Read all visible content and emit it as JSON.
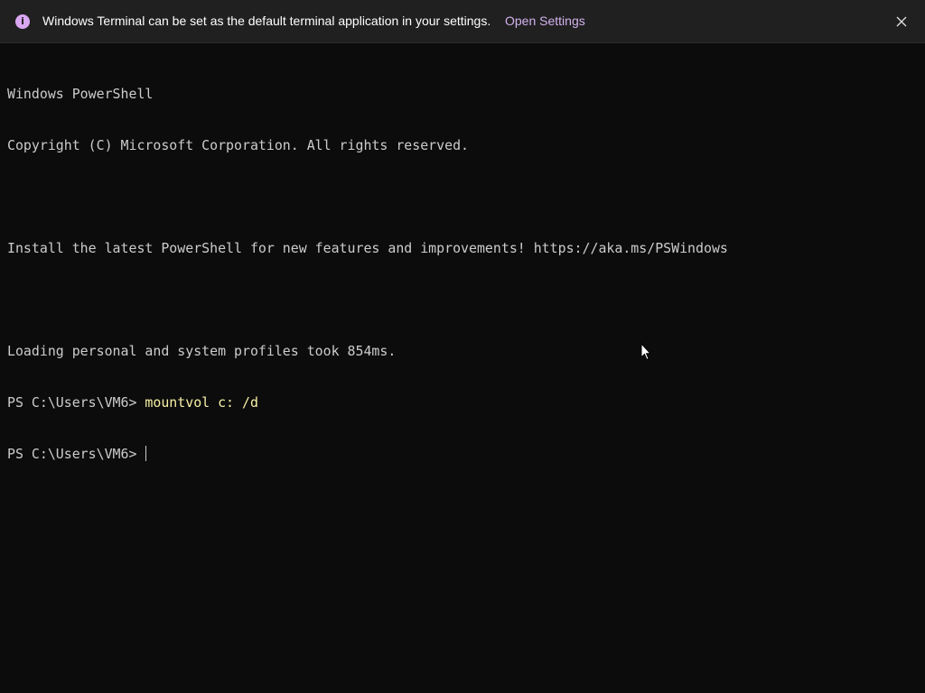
{
  "infobar": {
    "icon": "info-icon",
    "icon_glyph": "i",
    "icon_color": "#d9a6f2",
    "message": "Windows Terminal can be set as the default terminal application in your settings.",
    "link_label": "Open Settings",
    "link_color": "#d2b3ef",
    "close_icon": "close-icon"
  },
  "terminal": {
    "background": "#0c0c0c",
    "foreground": "#cccccc",
    "command_color": "#f9f1a5",
    "lines": [
      "Windows PowerShell",
      "Copyright (C) Microsoft Corporation. All rights reserved.",
      "",
      "Install the latest PowerShell for new features and improvements! https://aka.ms/PSWindows",
      "",
      "Loading personal and system profiles took 854ms."
    ],
    "history": {
      "prompt": "PS C:\\Users\\VM6> ",
      "command": "mountvol c: /d"
    },
    "current_prompt": "PS C:\\Users\\VM6> "
  }
}
